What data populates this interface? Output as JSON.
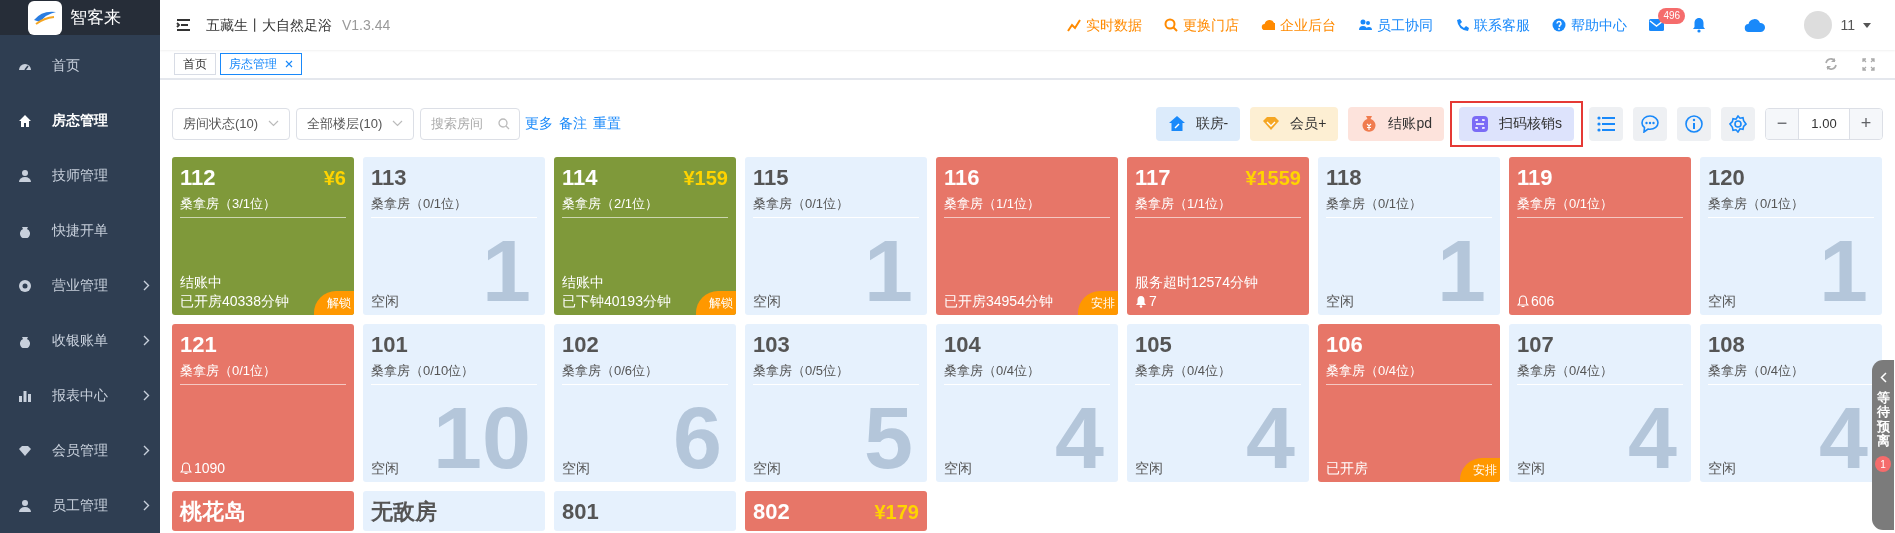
{
  "sidebar": {
    "logo_text": "智客来",
    "items": [
      {
        "label": "首页",
        "selected": false,
        "has_submenu": false
      },
      {
        "label": "房态管理",
        "selected": true,
        "has_submenu": false
      },
      {
        "label": "技师管理",
        "selected": false,
        "has_submenu": false
      },
      {
        "label": "快捷开单",
        "selected": false,
        "has_submenu": false
      },
      {
        "label": "营业管理",
        "selected": false,
        "has_submenu": true
      },
      {
        "label": "收银账单",
        "selected": false,
        "has_submenu": true
      },
      {
        "label": "报表中心",
        "selected": false,
        "has_submenu": true
      },
      {
        "label": "会员管理",
        "selected": false,
        "has_submenu": true
      },
      {
        "label": "员工管理",
        "selected": false,
        "has_submenu": true
      }
    ]
  },
  "header": {
    "store": "五藏生丨大自然足浴",
    "version": "V1.3.44",
    "links": [
      {
        "label": "实时数据",
        "kind": "chart",
        "color": "#ff8a00"
      },
      {
        "label": "更换门店",
        "kind": "search",
        "color": "#ff8a00"
      },
      {
        "label": "企业后台",
        "kind": "cloud",
        "color": "#ff8a00"
      },
      {
        "label": "员工协同",
        "kind": "people",
        "color": "#1989fa"
      },
      {
        "label": "联系客服",
        "kind": "phone",
        "color": "#1989fa"
      },
      {
        "label": "帮助中心",
        "kind": "help",
        "color": "#1989fa"
      }
    ],
    "mail_count": "496",
    "user": "11"
  },
  "tabs": [
    {
      "label": "首页",
      "selected": false,
      "closable": false
    },
    {
      "label": "房态管理",
      "selected": true,
      "closable": true
    }
  ],
  "filters": {
    "selects": [
      "房间状态(10)",
      "全部楼层(10)"
    ],
    "search": {
      "placeholder": "搜索房间"
    },
    "links": [
      "更多",
      "备注",
      "重置"
    ]
  },
  "actions": [
    {
      "label": "联房-",
      "kind": "house",
      "highlighted": false
    },
    {
      "label": "会员+",
      "kind": "diamond",
      "highlighted": false
    },
    {
      "label": "结账pd",
      "kind": "moneybag",
      "highlighted": false
    },
    {
      "label": "扫码核销s",
      "kind": "scan",
      "highlighted": true
    }
  ],
  "icon_buttons": [
    {
      "kind": "list"
    },
    {
      "kind": "chat"
    },
    {
      "kind": "info"
    },
    {
      "kind": "settings"
    }
  ],
  "zoom": {
    "minus": "−",
    "value": "1.00",
    "plus": "+"
  },
  "rooms": [
    {
      "number": "112",
      "price": "¥6",
      "type": "桑拿房（3/1位）",
      "color": "#7f993a",
      "lines": [
        "结账中",
        "已开房40338分钟"
      ],
      "badge": "解锁"
    },
    {
      "number": "113",
      "type": "桑拿房（0/1位）",
      "color": "#e6f1fd",
      "lines": [
        "空闲"
      ],
      "capacity": "1"
    },
    {
      "number": "114",
      "price": "¥159",
      "type": "桑拿房（2/1位）",
      "color": "#7f993a",
      "lines": [
        "结账中",
        "已下钟40193分钟"
      ],
      "badge": "解锁"
    },
    {
      "number": "115",
      "type": "桑拿房（0/1位）",
      "color": "#e6f1fd",
      "lines": [
        "空闲"
      ],
      "capacity": "1"
    },
    {
      "number": "116",
      "type": "桑拿房（1/1位）",
      "color": "#e77668",
      "lines": [
        "已开房34954分钟"
      ],
      "badge": "安排"
    },
    {
      "number": "117",
      "price": "¥1559",
      "type": "桑拿房（1/1位）",
      "color": "#e77668",
      "lines": [
        "服务超时12574分钟"
      ],
      "alert": {
        "kind": "filled",
        "text": "7"
      }
    },
    {
      "number": "118",
      "type": "桑拿房（0/1位）",
      "color": "#e6f1fd",
      "lines": [
        "空闲"
      ],
      "capacity": "1"
    },
    {
      "number": "119",
      "type": "桑拿房（0/1位）",
      "color": "#e77668",
      "alert": {
        "kind": "outline",
        "text": "606"
      }
    },
    {
      "number": "120",
      "type": "桑拿房（0/1位）",
      "color": "#e6f1fd",
      "lines": [
        "空闲"
      ],
      "capacity": "1"
    },
    {
      "number": "121",
      "type": "桑拿房（0/1位）",
      "color": "#e77668",
      "alert": {
        "kind": "outline",
        "text": "1090"
      }
    },
    {
      "number": "101",
      "type": "桑拿房（0/10位）",
      "color": "#e6f1fd",
      "lines": [
        "空闲"
      ],
      "capacity": "10"
    },
    {
      "number": "102",
      "type": "桑拿房（0/6位）",
      "color": "#e6f1fd",
      "lines": [
        "空闲"
      ],
      "capacity": "6"
    },
    {
      "number": "103",
      "type": "桑拿房（0/5位）",
      "color": "#e6f1fd",
      "lines": [
        "空闲"
      ],
      "capacity": "5"
    },
    {
      "number": "104",
      "type": "桑拿房（0/4位）",
      "color": "#e6f1fd",
      "lines": [
        "空闲"
      ],
      "capacity": "4"
    },
    {
      "number": "105",
      "type": "桑拿房（0/4位）",
      "color": "#e6f1fd",
      "lines": [
        "空闲"
      ],
      "capacity": "4"
    },
    {
      "number": "106",
      "type": "桑拿房（0/4位）",
      "color": "#e77668",
      "lines": [
        "已开房"
      ],
      "badge": "安排"
    },
    {
      "number": "107",
      "type": "桑拿房（0/4位）",
      "color": "#e6f1fd",
      "lines": [
        "空闲"
      ],
      "capacity": "4"
    },
    {
      "number": "108",
      "type": "桑拿房（0/4位）",
      "color": "#e6f1fd",
      "lines": [
        "空闲"
      ],
      "capacity": "4"
    },
    {
      "number": "桃花岛",
      "color": "#e77668"
    },
    {
      "number": "无敌房",
      "color": "#e6f1fd"
    },
    {
      "number": "801",
      "color": "#e6f1fd"
    },
    {
      "number": "802",
      "price": "¥179",
      "color": "#e77668"
    }
  ],
  "side_tab": {
    "label": "等待预离",
    "count": "1"
  }
}
